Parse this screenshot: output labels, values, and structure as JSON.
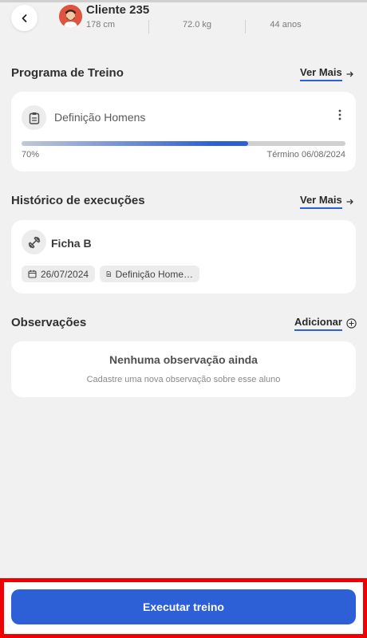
{
  "header": {
    "client_name": "Cliente 235",
    "height": "178 cm",
    "weight": "72.0 kg",
    "age": "44 anos"
  },
  "program": {
    "section_title": "Programa de Treino",
    "more_label": "Ver Mais",
    "name": "Definição Homens",
    "progress_percent": 70,
    "progress_label": "70%",
    "end_label": "Término 06/08/2024"
  },
  "history": {
    "section_title": "Histórico de execuções",
    "more_label": "Ver Mais",
    "item_title": "Ficha B",
    "date": "26/07/2024",
    "program": "Definição Home…"
  },
  "notes": {
    "section_title": "Observações",
    "add_label": "Adicionar",
    "empty_title": "Nenhuma observação ainda",
    "empty_subtitle": "Cadastre uma nova observação sobre esse aluno"
  },
  "footer": {
    "button_label": "Executar treino"
  },
  "colors": {
    "accent": "#2d5fd6",
    "background": "#f1f1f1",
    "card": "#ffffff",
    "highlight": "#f00000"
  },
  "icons": {
    "back": "chevron-left-icon",
    "arrow": "arrow-right-icon",
    "program": "clipboard-icon",
    "menu": "kebab-menu-icon",
    "history": "dumbbell-icon",
    "date": "calendar-icon",
    "doc": "document-icon",
    "add": "plus-circle-icon"
  }
}
